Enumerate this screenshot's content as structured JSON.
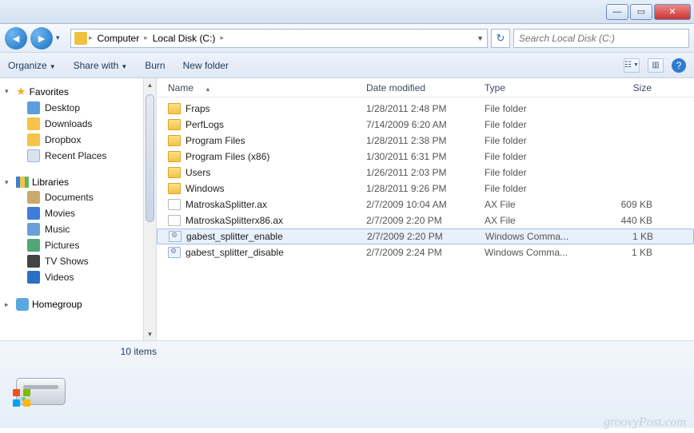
{
  "titlebar": {
    "min": "—",
    "max": "▭",
    "close": "✕"
  },
  "nav": {
    "breadcrumb": {
      "root_sep": "▸",
      "computer": "Computer",
      "disk": "Local Disk (C:)"
    },
    "drop": "▾",
    "refresh": "↻",
    "search_placeholder": "Search Local Disk (C:)"
  },
  "toolbar": {
    "organize": "Organize",
    "share": "Share with",
    "burn": "Burn",
    "newfolder": "New folder",
    "caret": "▼"
  },
  "sidebar": {
    "favorites": {
      "label": "Favorites",
      "items": [
        "Desktop",
        "Downloads",
        "Dropbox",
        "Recent Places"
      ]
    },
    "libraries": {
      "label": "Libraries",
      "items": [
        "Documents",
        "Movies",
        "Music",
        "Pictures",
        "TV Shows",
        "Videos"
      ]
    },
    "homegroup": "Homegroup"
  },
  "columns": {
    "name": "Name",
    "date": "Date modified",
    "type": "Type",
    "size": "Size"
  },
  "rows": [
    {
      "icon": "folder",
      "name": "Fraps",
      "date": "1/28/2011 2:48 PM",
      "type": "File folder",
      "size": ""
    },
    {
      "icon": "folder",
      "name": "PerfLogs",
      "date": "7/14/2009 6:20 AM",
      "type": "File folder",
      "size": ""
    },
    {
      "icon": "folder",
      "name": "Program Files",
      "date": "1/28/2011 2:38 PM",
      "type": "File folder",
      "size": ""
    },
    {
      "icon": "folder",
      "name": "Program Files (x86)",
      "date": "1/30/2011 6:31 PM",
      "type": "File folder",
      "size": ""
    },
    {
      "icon": "folder",
      "name": "Users",
      "date": "1/26/2011 2:03 PM",
      "type": "File folder",
      "size": ""
    },
    {
      "icon": "folder",
      "name": "Windows",
      "date": "1/28/2011 9:26 PM",
      "type": "File folder",
      "size": ""
    },
    {
      "icon": "file",
      "name": "MatroskaSplitter.ax",
      "date": "2/7/2009 10:04 AM",
      "type": "AX File",
      "size": "609 KB"
    },
    {
      "icon": "file",
      "name": "MatroskaSplitterx86.ax",
      "date": "2/7/2009 2:20 PM",
      "type": "AX File",
      "size": "440 KB"
    },
    {
      "icon": "cmd",
      "name": "gabest_splitter_enable",
      "date": "2/7/2009 2:20 PM",
      "type": "Windows Comma...",
      "size": "1 KB",
      "selected": true
    },
    {
      "icon": "cmd",
      "name": "gabest_splitter_disable",
      "date": "2/7/2009 2:24 PM",
      "type": "Windows Comma...",
      "size": "1 KB"
    }
  ],
  "status": {
    "count": "10 items"
  },
  "watermark": "groovyPost.com"
}
